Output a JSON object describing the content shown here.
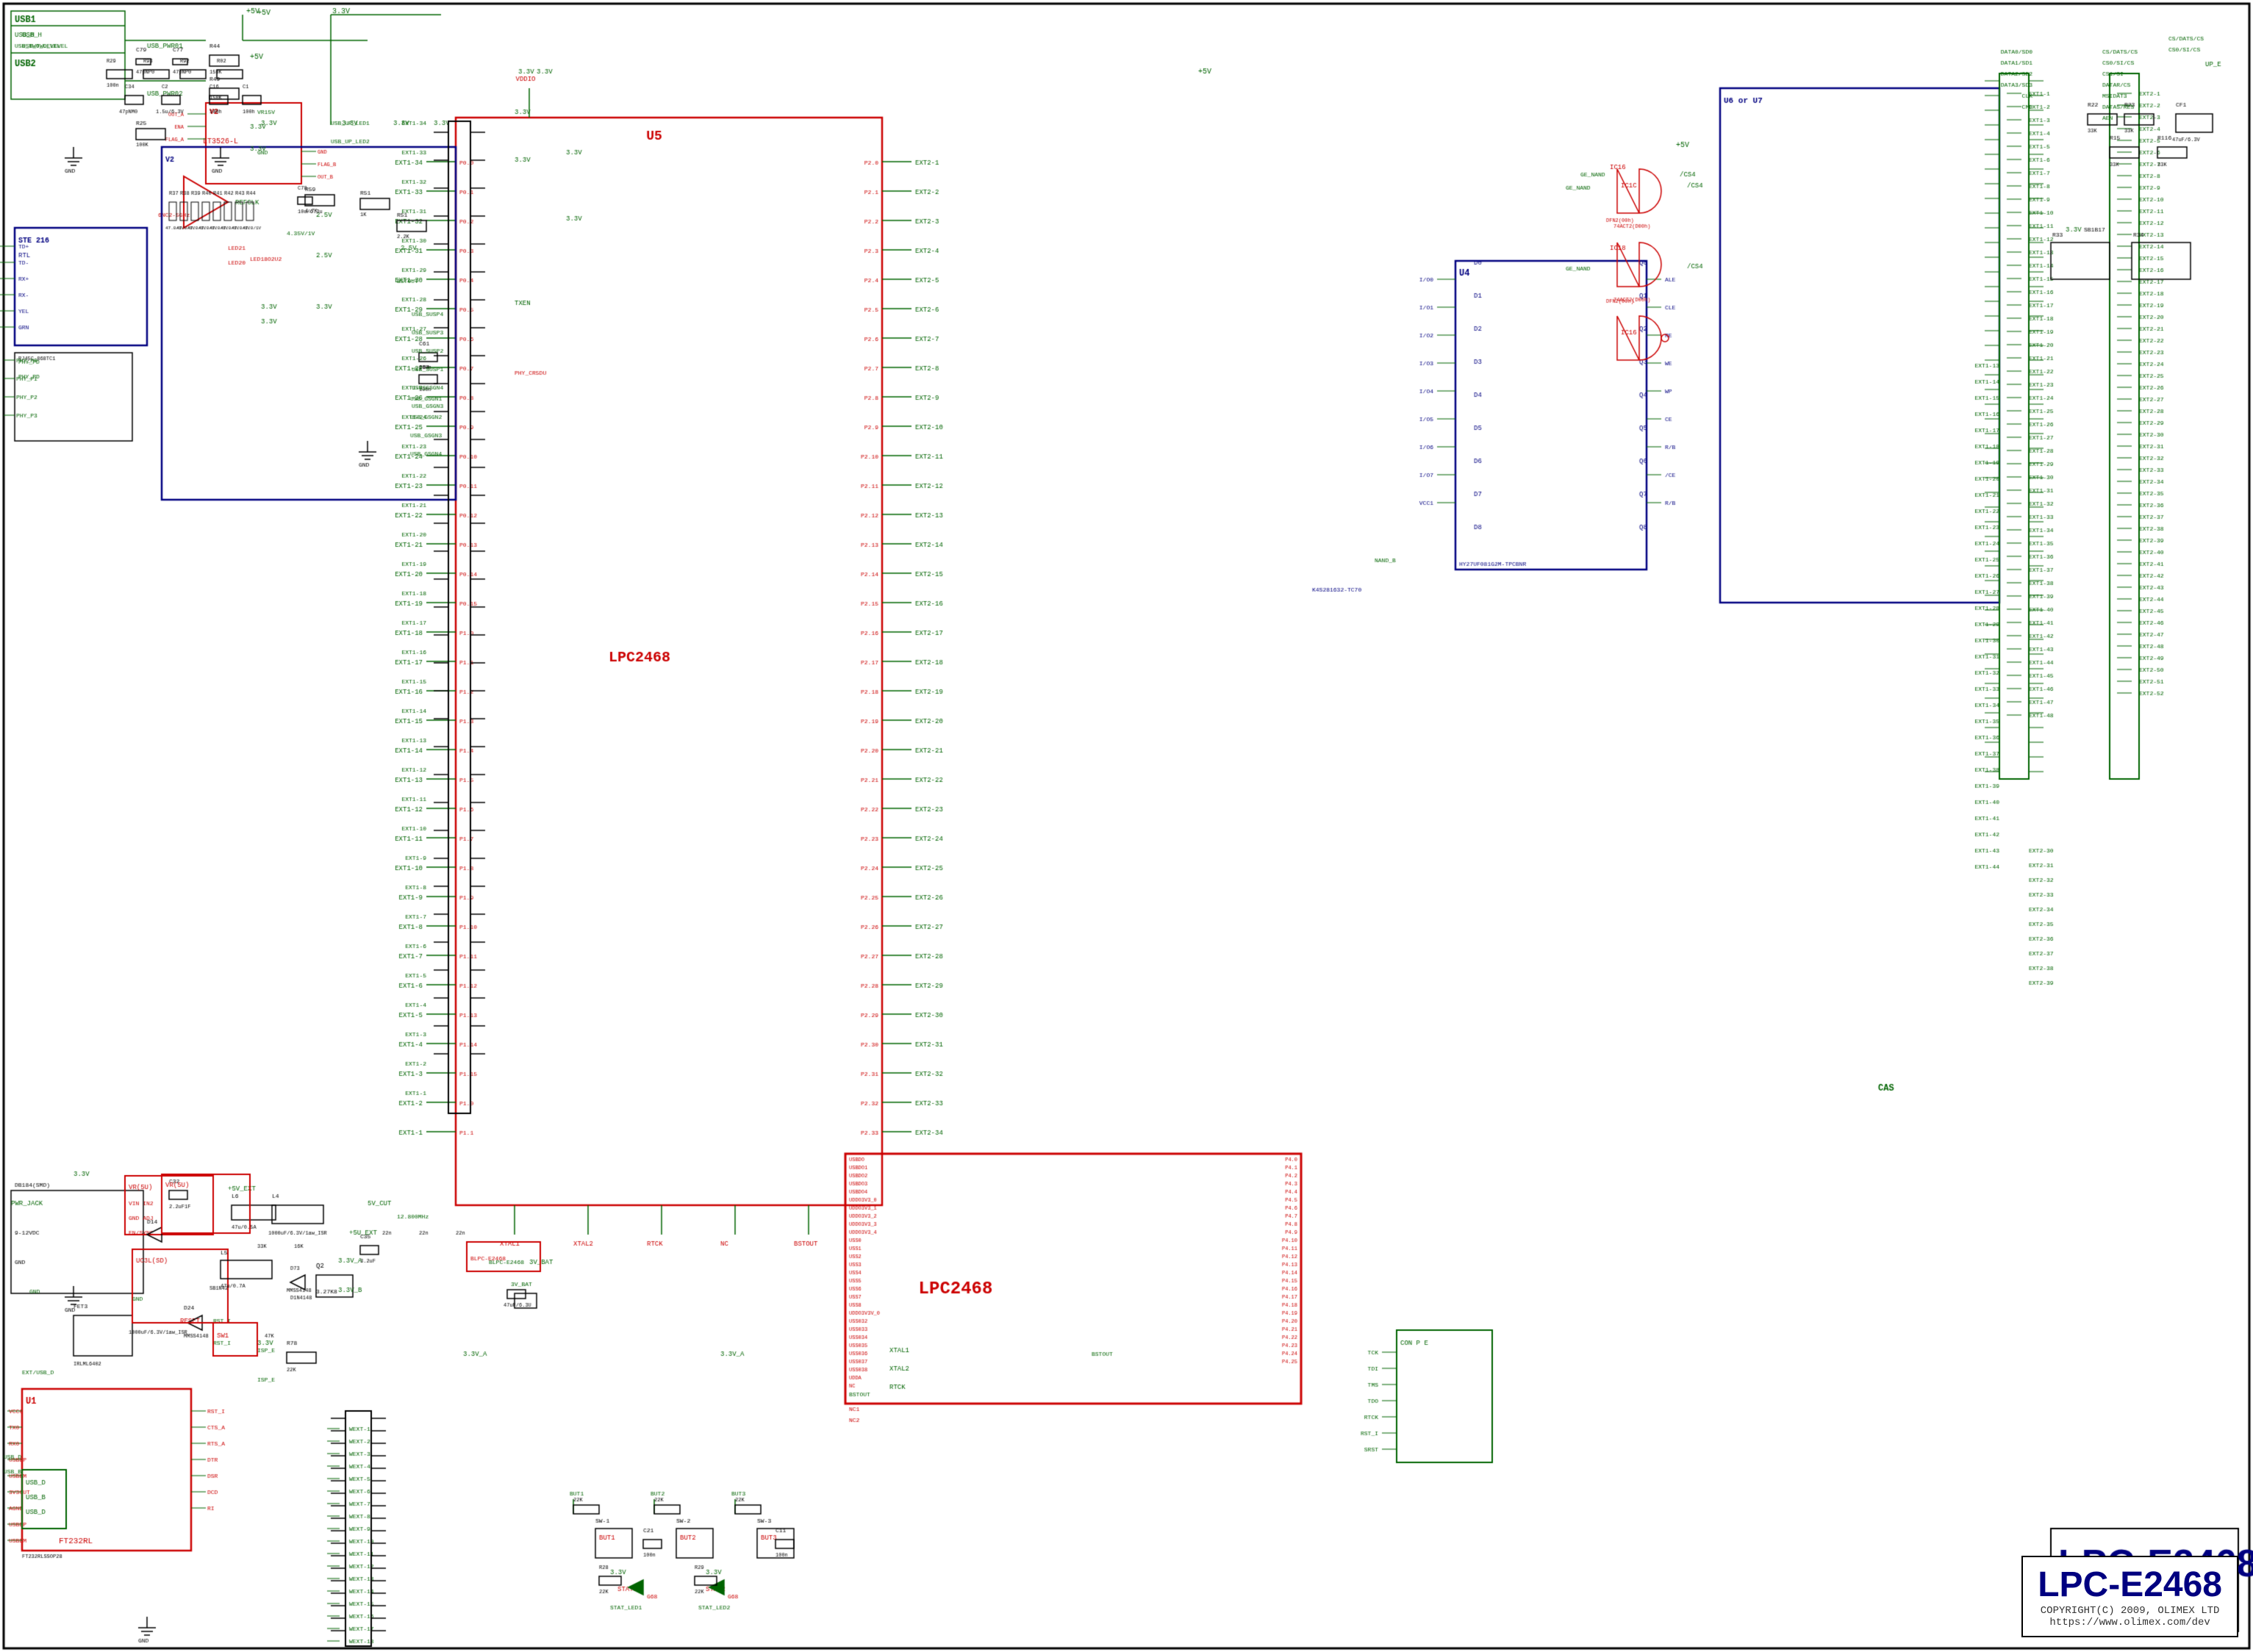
{
  "schematic": {
    "title": "LPC-E2468",
    "copyright": "COPYRIGHT(C) 2009, OLIMEX LTD",
    "website": "https://www.olimex.com/dev",
    "background_color": "#ffffff",
    "border_color": "#000000",
    "wire_color_green": "#006400",
    "wire_color_red": "#cc0000",
    "component_color_red": "#cc0000",
    "component_color_blue": "#000080",
    "label_color_green": "#006400",
    "main_ic": "U5",
    "main_ic_label": "LPC2468",
    "cas_label": "CAS"
  }
}
